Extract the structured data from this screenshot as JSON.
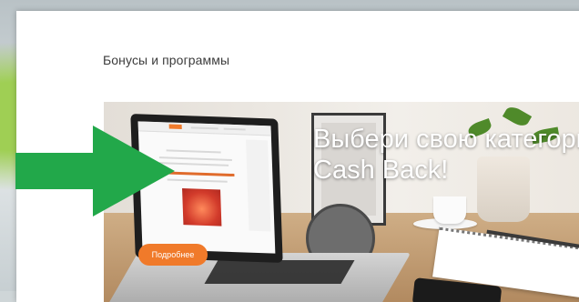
{
  "section": {
    "title": "Бонусы и программы"
  },
  "banner": {
    "heading_line1": "Выбери свою категори",
    "heading_line2": "Cash Back!",
    "more_button_label": "Подробнее"
  },
  "colors": {
    "accent_orange": "#f07a2a",
    "arrow_green": "#22a84a",
    "page_bg": "#ffffff"
  },
  "icons": {
    "arrow": "arrow-right-icon"
  }
}
